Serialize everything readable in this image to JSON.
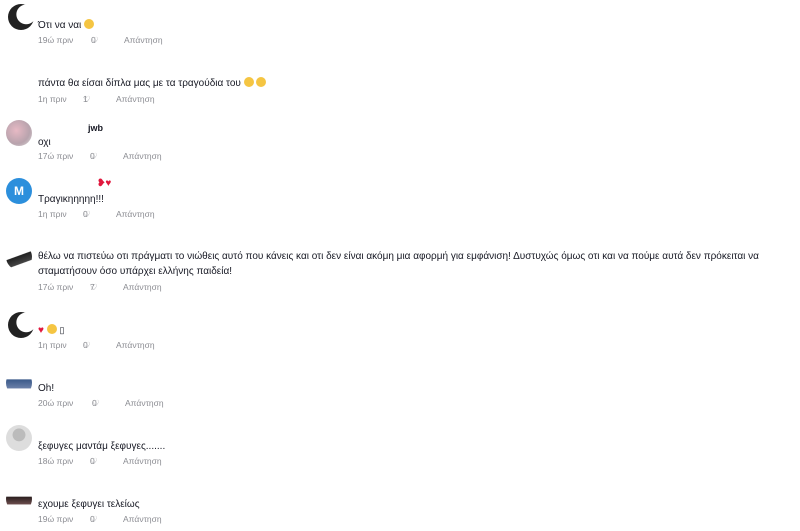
{
  "labels": {
    "reply": "Απάντηση"
  },
  "comments": [
    {
      "username": "",
      "text": "Ότι να ναι",
      "time": "19ώ πριν",
      "likes": "0"
    },
    {
      "username": "",
      "text": "πάντα θα είσαι δίπλα μας με τα τραγούδια του",
      "time": "1η πριν",
      "likes": "1"
    },
    {
      "username": "jwb",
      "text": "οχι",
      "time": "17ώ πριν",
      "likes": "0"
    },
    {
      "username": "",
      "text": "Τραγικηηηηη!!!",
      "time": "1η πριν",
      "likes": "0",
      "avatar_letter": "M"
    },
    {
      "username": "",
      "text": "θέλω να πιστεύω οτι πράγματι το νιώθεις αυτό που κάνεις και οτι δεν είναι ακόμη μια αφορμή για εμφάνιση! Δυστυχώς όμως οτι και να πούμε αυτά δεν πρόκειται να σταματήσουν όσο υπάρχει ελλήνης παιδεία!",
      "time": "17ώ πριν",
      "likes": "7"
    },
    {
      "username": "",
      "text": "",
      "time": "1η πριν",
      "likes": "0"
    },
    {
      "username": "",
      "text": "Oh!",
      "time": "20ώ πριν",
      "likes": "0"
    },
    {
      "username": "",
      "text": "ξεφυγες μαντάμ ξεφυγες.......",
      "time": "18ώ πριν",
      "likes": "0"
    },
    {
      "username": "",
      "text": "εχουμε ξεφυγει τελείως",
      "time": "19ώ πριν",
      "likes": "0"
    }
  ]
}
